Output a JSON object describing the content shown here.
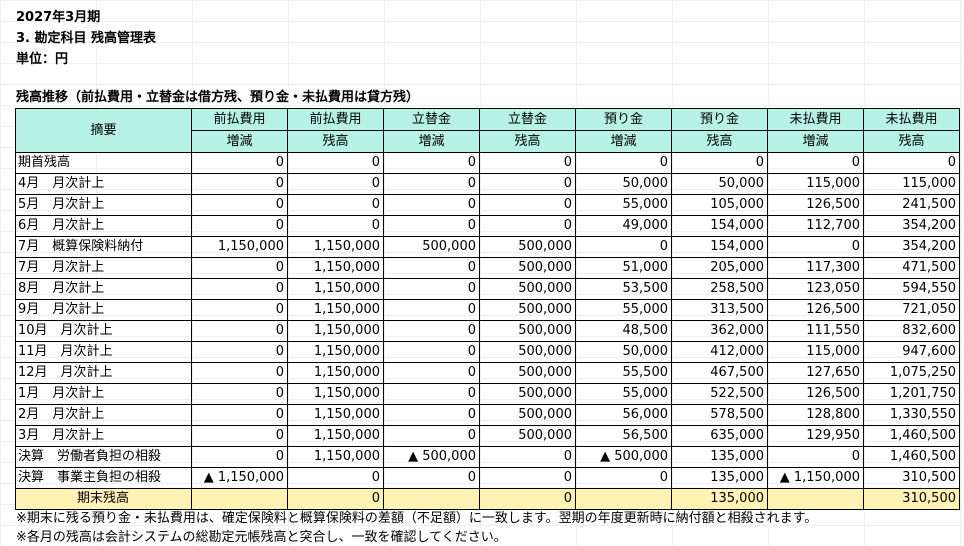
{
  "header": {
    "period": "2027年3月期",
    "title": "3. 勘定科目 残高管理表",
    "unit": "単位：円",
    "section": "残高推移（前払費用・立替金は借方残、預り金・未払費用は貸方残）"
  },
  "columns": [
    {
      "top": "摘要",
      "bottom": ""
    },
    {
      "top": "前払費用",
      "bottom": "増減"
    },
    {
      "top": "前払費用",
      "bottom": "残高"
    },
    {
      "top": "立替金",
      "bottom": "増減"
    },
    {
      "top": "立替金",
      "bottom": "残高"
    },
    {
      "top": "預り金",
      "bottom": "増減"
    },
    {
      "top": "預り金",
      "bottom": "残高"
    },
    {
      "top": "未払費用",
      "bottom": "増減"
    },
    {
      "top": "未払費用",
      "bottom": "残高"
    }
  ],
  "rows": [
    [
      "期首残高",
      "0",
      "0",
      "0",
      "0",
      "0",
      "0",
      "0",
      "0"
    ],
    [
      "4月　月次計上",
      "0",
      "0",
      "0",
      "0",
      "50,000",
      "50,000",
      "115,000",
      "115,000"
    ],
    [
      "5月　月次計上",
      "0",
      "0",
      "0",
      "0",
      "55,000",
      "105,000",
      "126,500",
      "241,500"
    ],
    [
      "6月　月次計上",
      "0",
      "0",
      "0",
      "0",
      "49,000",
      "154,000",
      "112,700",
      "354,200"
    ],
    [
      "7月　概算保険料納付",
      "1,150,000",
      "1,150,000",
      "500,000",
      "500,000",
      "0",
      "154,000",
      "0",
      "354,200"
    ],
    [
      "7月　月次計上",
      "0",
      "1,150,000",
      "0",
      "500,000",
      "51,000",
      "205,000",
      "117,300",
      "471,500"
    ],
    [
      "8月　月次計上",
      "0",
      "1,150,000",
      "0",
      "500,000",
      "53,500",
      "258,500",
      "123,050",
      "594,550"
    ],
    [
      "9月　月次計上",
      "0",
      "1,150,000",
      "0",
      "500,000",
      "55,000",
      "313,500",
      "126,500",
      "721,050"
    ],
    [
      "10月　月次計上",
      "0",
      "1,150,000",
      "0",
      "500,000",
      "48,500",
      "362,000",
      "111,550",
      "832,600"
    ],
    [
      "11月　月次計上",
      "0",
      "1,150,000",
      "0",
      "500,000",
      "50,000",
      "412,000",
      "115,000",
      "947,600"
    ],
    [
      "12月　月次計上",
      "0",
      "1,150,000",
      "0",
      "500,000",
      "55,500",
      "467,500",
      "127,650",
      "1,075,250"
    ],
    [
      "1月　月次計上",
      "0",
      "1,150,000",
      "0",
      "500,000",
      "55,000",
      "522,500",
      "126,500",
      "1,201,750"
    ],
    [
      "2月　月次計上",
      "0",
      "1,150,000",
      "0",
      "500,000",
      "56,000",
      "578,500",
      "128,800",
      "1,330,550"
    ],
    [
      "3月　月次計上",
      "0",
      "1,150,000",
      "0",
      "500,000",
      "56,500",
      "635,000",
      "129,950",
      "1,460,500"
    ],
    [
      "決算　労働者負担の相殺",
      "0",
      "1,150,000",
      "▲ 500,000",
      "0",
      "▲ 500,000",
      "135,000",
      "0",
      "1,460,500"
    ],
    [
      "決算　事業主負担の相殺",
      "▲ 1,150,000",
      "0",
      "0",
      "0",
      "0",
      "135,000",
      "▲ 1,150,000",
      "310,500"
    ]
  ],
  "total_row": [
    "期末残高",
    "",
    "0",
    "",
    "0",
    "",
    "135,000",
    "",
    "310,500"
  ],
  "notes": [
    "※期末に残る預り金・未払費用は、確定保険料と概算保険料の差額（不足額）に一致します。翌期の年度更新時に納付額と相殺されます。",
    "※各月の残高は会計システムの総勘定元帳残高と突合し、一致を確認してください。"
  ],
  "colors": {
    "header_fill": "#b7f3e4",
    "total_fill": "#fff2b3"
  }
}
